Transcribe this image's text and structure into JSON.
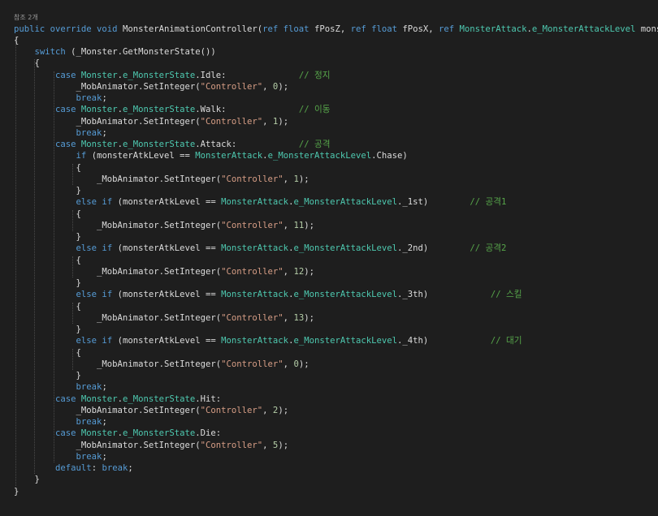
{
  "codelens": "참조 2개",
  "colors": {
    "background": "#1e1e1e",
    "plain": "#dcdcdc",
    "keyword": "#569cd6",
    "type": "#4ec9b0",
    "string": "#d69d85",
    "number": "#b5cea8",
    "comment": "#57a64a"
  },
  "lines": [
    [
      [
        "kw",
        "public override void "
      ],
      [
        "tx",
        "MonsterAnimationController("
      ],
      [
        "kw",
        "ref float "
      ],
      [
        "tx",
        "fPosZ, "
      ],
      [
        "kw",
        "ref float "
      ],
      [
        "tx",
        "fPosX, "
      ],
      [
        "kw",
        "ref "
      ],
      [
        "ty",
        "MonsterAttack"
      ],
      [
        "tx",
        "."
      ],
      [
        "ty",
        "e_MonsterAttackLevel"
      ],
      [
        "tx",
        " monsterAtkLevel)"
      ]
    ],
    [
      [
        "tx",
        "{"
      ]
    ],
    [
      [
        "tx",
        "    "
      ],
      [
        "kw",
        "switch"
      ],
      [
        "tx",
        " (_Monster.GetMonsterState())"
      ]
    ],
    [
      [
        "tx",
        "    {"
      ]
    ],
    [
      [
        "tx",
        "        "
      ],
      [
        "kw",
        "case "
      ],
      [
        "ty",
        "Monster"
      ],
      [
        "tx",
        "."
      ],
      [
        "ty",
        "e_MonsterState"
      ],
      [
        "tx",
        ".Idle:              "
      ],
      [
        "cm",
        "// 정지"
      ]
    ],
    [
      [
        "tx",
        "            _MobAnimator.SetInteger("
      ],
      [
        "str",
        "\"Controller\""
      ],
      [
        "tx",
        ", "
      ],
      [
        "num",
        "0"
      ],
      [
        "tx",
        ");"
      ]
    ],
    [
      [
        "tx",
        "            "
      ],
      [
        "kw",
        "break"
      ],
      [
        "tx",
        ";"
      ]
    ],
    [
      [
        "tx",
        "        "
      ],
      [
        "kw",
        "case "
      ],
      [
        "ty",
        "Monster"
      ],
      [
        "tx",
        "."
      ],
      [
        "ty",
        "e_MonsterState"
      ],
      [
        "tx",
        ".Walk:              "
      ],
      [
        "cm",
        "// 이동"
      ]
    ],
    [
      [
        "tx",
        "            _MobAnimator.SetInteger("
      ],
      [
        "str",
        "\"Controller\""
      ],
      [
        "tx",
        ", "
      ],
      [
        "num",
        "1"
      ],
      [
        "tx",
        ");"
      ]
    ],
    [
      [
        "tx",
        "            "
      ],
      [
        "kw",
        "break"
      ],
      [
        "tx",
        ";"
      ]
    ],
    [
      [
        "tx",
        "        "
      ],
      [
        "kw",
        "case "
      ],
      [
        "ty",
        "Monster"
      ],
      [
        "tx",
        "."
      ],
      [
        "ty",
        "e_MonsterState"
      ],
      [
        "tx",
        ".Attack:            "
      ],
      [
        "cm",
        "// 공격"
      ]
    ],
    [
      [
        "tx",
        "            "
      ],
      [
        "kw",
        "if"
      ],
      [
        "tx",
        " (monsterAtkLevel == "
      ],
      [
        "ty",
        "MonsterAttack"
      ],
      [
        "tx",
        "."
      ],
      [
        "ty",
        "e_MonsterAttackLevel"
      ],
      [
        "tx",
        ".Chase)"
      ]
    ],
    [
      [
        "tx",
        "            {"
      ]
    ],
    [
      [
        "tx",
        "                _MobAnimator.SetInteger("
      ],
      [
        "str",
        "\"Controller\""
      ],
      [
        "tx",
        ", "
      ],
      [
        "num",
        "1"
      ],
      [
        "tx",
        ");"
      ]
    ],
    [
      [
        "tx",
        "            }"
      ]
    ],
    [
      [
        "tx",
        "            "
      ],
      [
        "kw",
        "else if"
      ],
      [
        "tx",
        " (monsterAtkLevel == "
      ],
      [
        "ty",
        "MonsterAttack"
      ],
      [
        "tx",
        "."
      ],
      [
        "ty",
        "e_MonsterAttackLevel"
      ],
      [
        "tx",
        "._1st)        "
      ],
      [
        "cm",
        "// 공격1"
      ]
    ],
    [
      [
        "tx",
        "            {"
      ]
    ],
    [
      [
        "tx",
        "                _MobAnimator.SetInteger("
      ],
      [
        "str",
        "\"Controller\""
      ],
      [
        "tx",
        ", "
      ],
      [
        "num",
        "11"
      ],
      [
        "tx",
        ");"
      ]
    ],
    [
      [
        "tx",
        "            }"
      ]
    ],
    [
      [
        "tx",
        "            "
      ],
      [
        "kw",
        "else if"
      ],
      [
        "tx",
        " (monsterAtkLevel == "
      ],
      [
        "ty",
        "MonsterAttack"
      ],
      [
        "tx",
        "."
      ],
      [
        "ty",
        "e_MonsterAttackLevel"
      ],
      [
        "tx",
        "._2nd)        "
      ],
      [
        "cm",
        "// 공격2"
      ]
    ],
    [
      [
        "tx",
        "            {"
      ]
    ],
    [
      [
        "tx",
        "                _MobAnimator.SetInteger("
      ],
      [
        "str",
        "\"Controller\""
      ],
      [
        "tx",
        ", "
      ],
      [
        "num",
        "12"
      ],
      [
        "tx",
        ");"
      ]
    ],
    [
      [
        "tx",
        "            }"
      ]
    ],
    [
      [
        "tx",
        "            "
      ],
      [
        "kw",
        "else if"
      ],
      [
        "tx",
        " (monsterAtkLevel == "
      ],
      [
        "ty",
        "MonsterAttack"
      ],
      [
        "tx",
        "."
      ],
      [
        "ty",
        "e_MonsterAttackLevel"
      ],
      [
        "tx",
        "._3th)            "
      ],
      [
        "cm",
        "// 스킬"
      ]
    ],
    [
      [
        "tx",
        "            {"
      ]
    ],
    [
      [
        "tx",
        "                _MobAnimator.SetInteger("
      ],
      [
        "str",
        "\"Controller\""
      ],
      [
        "tx",
        ", "
      ],
      [
        "num",
        "13"
      ],
      [
        "tx",
        ");"
      ]
    ],
    [
      [
        "tx",
        "            }"
      ]
    ],
    [
      [
        "tx",
        "            "
      ],
      [
        "kw",
        "else if"
      ],
      [
        "tx",
        " (monsterAtkLevel == "
      ],
      [
        "ty",
        "MonsterAttack"
      ],
      [
        "tx",
        "."
      ],
      [
        "ty",
        "e_MonsterAttackLevel"
      ],
      [
        "tx",
        "._4th)            "
      ],
      [
        "cm",
        "// 대기"
      ]
    ],
    [
      [
        "tx",
        "            {"
      ]
    ],
    [
      [
        "tx",
        "                _MobAnimator.SetInteger("
      ],
      [
        "str",
        "\"Controller\""
      ],
      [
        "tx",
        ", "
      ],
      [
        "num",
        "0"
      ],
      [
        "tx",
        ");"
      ]
    ],
    [
      [
        "tx",
        "            }"
      ]
    ],
    [
      [
        "tx",
        "            "
      ],
      [
        "kw",
        "break"
      ],
      [
        "tx",
        ";"
      ]
    ],
    [
      [
        "tx",
        "        "
      ],
      [
        "kw",
        "case "
      ],
      [
        "ty",
        "Monster"
      ],
      [
        "tx",
        "."
      ],
      [
        "ty",
        "e_MonsterState"
      ],
      [
        "tx",
        ".Hit:"
      ]
    ],
    [
      [
        "tx",
        "            _MobAnimator.SetInteger("
      ],
      [
        "str",
        "\"Controller\""
      ],
      [
        "tx",
        ", "
      ],
      [
        "num",
        "2"
      ],
      [
        "tx",
        ");"
      ]
    ],
    [
      [
        "tx",
        "            "
      ],
      [
        "kw",
        "break"
      ],
      [
        "tx",
        ";"
      ]
    ],
    [
      [
        "tx",
        "        "
      ],
      [
        "kw",
        "case "
      ],
      [
        "ty",
        "Monster"
      ],
      [
        "tx",
        "."
      ],
      [
        "ty",
        "e_MonsterState"
      ],
      [
        "tx",
        ".Die:"
      ]
    ],
    [
      [
        "tx",
        "            _MobAnimator.SetInteger("
      ],
      [
        "str",
        "\"Controller\""
      ],
      [
        "tx",
        ", "
      ],
      [
        "num",
        "5"
      ],
      [
        "tx",
        ");"
      ]
    ],
    [
      [
        "tx",
        "            "
      ],
      [
        "kw",
        "break"
      ],
      [
        "tx",
        ";"
      ]
    ],
    [
      [
        "tx",
        "        "
      ],
      [
        "kw",
        "default"
      ],
      [
        "tx",
        ": "
      ],
      [
        "kw",
        "break"
      ],
      [
        "tx",
        ";"
      ]
    ],
    [
      [
        "tx",
        "    }"
      ]
    ],
    [
      [
        "tx",
        "}"
      ]
    ]
  ]
}
